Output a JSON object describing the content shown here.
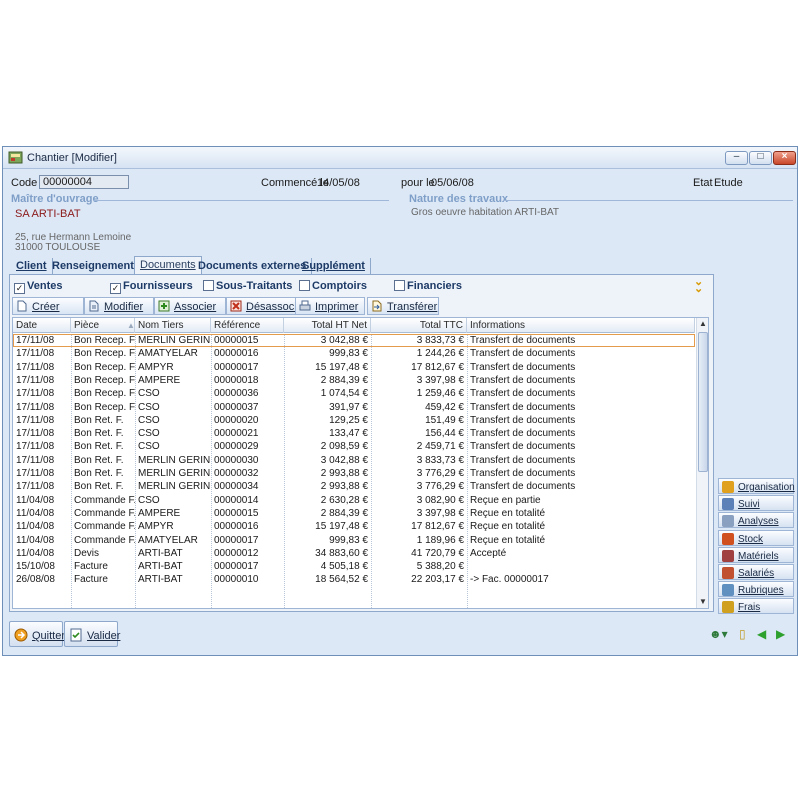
{
  "window": {
    "title": "Chantier [Modifier]"
  },
  "header": {
    "code_label": "Code",
    "code_value": "00000004",
    "start_label": "Commencé le",
    "start_value": "14/05/08",
    "end_label": "pour le",
    "end_value": "05/06/08",
    "etat_label": "Etat",
    "etat_value": "Etude"
  },
  "maitre": {
    "section_title": "Maître d'ouvrage",
    "name": "SA ARTI-BAT",
    "address1": "25, rue Hermann Lemoine",
    "address2": "31000 TOULOUSE"
  },
  "nature": {
    "section_title": "Nature des travaux",
    "text": "Gros oeuvre habitation ARTI-BAT"
  },
  "tabs": [
    {
      "label": "Client",
      "active": false
    },
    {
      "label": "Renseignements",
      "active": false
    },
    {
      "label": "Documents",
      "active": true
    },
    {
      "label": "Documents externes",
      "active": false
    },
    {
      "label": "Supplément",
      "active": false
    }
  ],
  "filters": [
    {
      "label": "Ventes",
      "checked": true
    },
    {
      "label": "Fournisseurs",
      "checked": true
    },
    {
      "label": "Sous-Traitants",
      "checked": false
    },
    {
      "label": "Comptoirs",
      "checked": false
    },
    {
      "label": "Financiers",
      "checked": false
    }
  ],
  "toolbar": [
    {
      "label": "Créer",
      "icon": "new-document-icon"
    },
    {
      "label": "Modifier",
      "icon": "edit-document-icon"
    },
    {
      "label": "Associer",
      "icon": "associate-icon"
    },
    {
      "label": "Désassocier",
      "icon": "dissociate-icon"
    },
    {
      "label": "Imprimer",
      "icon": "printer-icon"
    },
    {
      "label": "Transférer",
      "icon": "transfer-icon"
    }
  ],
  "table": {
    "columns": [
      "Date",
      "Pièce",
      "Nom Tiers",
      "Référence",
      "Total HT Net",
      "Total TTC",
      "Informations"
    ],
    "rows": [
      [
        "17/11/08",
        "Bon Recep. F.",
        "MERLIN GERIN",
        "00000015",
        "3 042,88 €",
        "3 833,73 €",
        "Transfert de documents"
      ],
      [
        "17/11/08",
        "Bon Recep. F.",
        "AMATYELAR",
        "00000016",
        "999,83 €",
        "1 244,26 €",
        "Transfert de documents"
      ],
      [
        "17/11/08",
        "Bon Recep. F.",
        "AMPYR",
        "00000017",
        "15 197,48 €",
        "17 812,67 €",
        "Transfert de documents"
      ],
      [
        "17/11/08",
        "Bon Recep. F.",
        "AMPERE",
        "00000018",
        "2 884,39 €",
        "3 397,98 €",
        "Transfert de documents"
      ],
      [
        "17/11/08",
        "Bon Recep. F.",
        "CSO",
        "00000036",
        "1 074,54 €",
        "1 259,46 €",
        "Transfert de documents"
      ],
      [
        "17/11/08",
        "Bon Recep. F.",
        "CSO",
        "00000037",
        "391,97 €",
        "459,42 €",
        "Transfert de documents"
      ],
      [
        "17/11/08",
        "Bon Ret. F.",
        "CSO",
        "00000020",
        "129,25 €",
        "151,49 €",
        "Transfert de documents"
      ],
      [
        "17/11/08",
        "Bon Ret. F.",
        "CSO",
        "00000021",
        "133,47 €",
        "156,44 €",
        "Transfert de documents"
      ],
      [
        "17/11/08",
        "Bon Ret. F.",
        "CSO",
        "00000029",
        "2 098,59 €",
        "2 459,71 €",
        "Transfert de documents"
      ],
      [
        "17/11/08",
        "Bon Ret. F.",
        "MERLIN GERIN",
        "00000030",
        "3 042,88 €",
        "3 833,73 €",
        "Transfert de documents"
      ],
      [
        "17/11/08",
        "Bon Ret. F.",
        "MERLIN GERIN",
        "00000032",
        "2 993,88 €",
        "3 776,29 €",
        "Transfert de documents"
      ],
      [
        "17/11/08",
        "Bon Ret. F.",
        "MERLIN GERIN",
        "00000034",
        "2 993,88 €",
        "3 776,29 €",
        "Transfert de documents"
      ],
      [
        "11/04/08",
        "Commande F.",
        "CSO",
        "00000014",
        "2 630,28 €",
        "3 082,90 €",
        "Reçue en partie"
      ],
      [
        "11/04/08",
        "Commande F.",
        "AMPERE",
        "00000015",
        "2 884,39 €",
        "3 397,98 €",
        "Reçue en totalité"
      ],
      [
        "11/04/08",
        "Commande F.",
        "AMPYR",
        "00000016",
        "15 197,48 €",
        "17 812,67 €",
        "Reçue en totalité"
      ],
      [
        "11/04/08",
        "Commande F.",
        "AMATYELAR",
        "00000017",
        "999,83 €",
        "1 189,96 €",
        "Reçue en totalité"
      ],
      [
        "11/04/08",
        "Devis",
        "ARTI-BAT",
        "00000012",
        "34 883,60 €",
        "41 720,79 €",
        "Accepté"
      ],
      [
        "15/10/08",
        "Facture",
        "ARTI-BAT",
        "00000017",
        "4 505,18 €",
        "5 388,20 €",
        ""
      ],
      [
        "26/08/08",
        "Facture",
        "ARTI-BAT",
        "00000010",
        "18 564,52 €",
        "22 203,17 €",
        "-> Fac. 00000017"
      ]
    ]
  },
  "side_buttons": [
    {
      "label": "Organisation",
      "icon": "organisation-icon"
    },
    {
      "label": "Suivi",
      "icon": "suivi-icon"
    },
    {
      "label": "Analyses",
      "icon": "analyses-icon"
    },
    {
      "label": "Stock",
      "icon": "stock-icon"
    },
    {
      "label": "Matériels",
      "icon": "materiels-icon"
    },
    {
      "label": "Salariés",
      "icon": "salaries-icon"
    },
    {
      "label": "Rubriques",
      "icon": "rubriques-icon"
    },
    {
      "label": "Frais",
      "icon": "frais-icon"
    }
  ],
  "bottom": {
    "quit_label": "Quitter",
    "validate_label": "Valider"
  }
}
